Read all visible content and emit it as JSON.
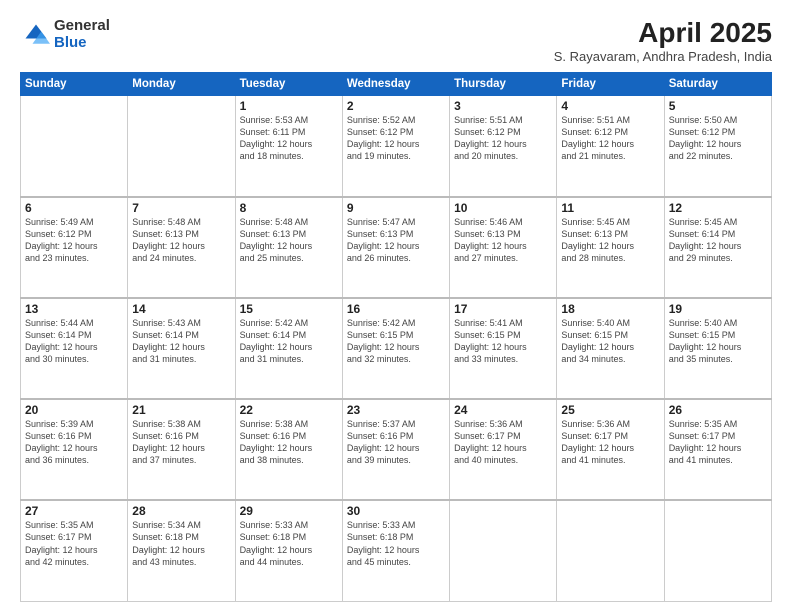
{
  "header": {
    "logo_general": "General",
    "logo_blue": "Blue",
    "title": "April 2025",
    "location": "S. Rayavaram, Andhra Pradesh, India"
  },
  "weekdays": [
    "Sunday",
    "Monday",
    "Tuesday",
    "Wednesday",
    "Thursday",
    "Friday",
    "Saturday"
  ],
  "weeks": [
    [
      {
        "day": "",
        "info": ""
      },
      {
        "day": "",
        "info": ""
      },
      {
        "day": "1",
        "info": "Sunrise: 5:53 AM\nSunset: 6:11 PM\nDaylight: 12 hours\nand 18 minutes."
      },
      {
        "day": "2",
        "info": "Sunrise: 5:52 AM\nSunset: 6:12 PM\nDaylight: 12 hours\nand 19 minutes."
      },
      {
        "day": "3",
        "info": "Sunrise: 5:51 AM\nSunset: 6:12 PM\nDaylight: 12 hours\nand 20 minutes."
      },
      {
        "day": "4",
        "info": "Sunrise: 5:51 AM\nSunset: 6:12 PM\nDaylight: 12 hours\nand 21 minutes."
      },
      {
        "day": "5",
        "info": "Sunrise: 5:50 AM\nSunset: 6:12 PM\nDaylight: 12 hours\nand 22 minutes."
      }
    ],
    [
      {
        "day": "6",
        "info": "Sunrise: 5:49 AM\nSunset: 6:12 PM\nDaylight: 12 hours\nand 23 minutes."
      },
      {
        "day": "7",
        "info": "Sunrise: 5:48 AM\nSunset: 6:13 PM\nDaylight: 12 hours\nand 24 minutes."
      },
      {
        "day": "8",
        "info": "Sunrise: 5:48 AM\nSunset: 6:13 PM\nDaylight: 12 hours\nand 25 minutes."
      },
      {
        "day": "9",
        "info": "Sunrise: 5:47 AM\nSunset: 6:13 PM\nDaylight: 12 hours\nand 26 minutes."
      },
      {
        "day": "10",
        "info": "Sunrise: 5:46 AM\nSunset: 6:13 PM\nDaylight: 12 hours\nand 27 minutes."
      },
      {
        "day": "11",
        "info": "Sunrise: 5:45 AM\nSunset: 6:13 PM\nDaylight: 12 hours\nand 28 minutes."
      },
      {
        "day": "12",
        "info": "Sunrise: 5:45 AM\nSunset: 6:14 PM\nDaylight: 12 hours\nand 29 minutes."
      }
    ],
    [
      {
        "day": "13",
        "info": "Sunrise: 5:44 AM\nSunset: 6:14 PM\nDaylight: 12 hours\nand 30 minutes."
      },
      {
        "day": "14",
        "info": "Sunrise: 5:43 AM\nSunset: 6:14 PM\nDaylight: 12 hours\nand 31 minutes."
      },
      {
        "day": "15",
        "info": "Sunrise: 5:42 AM\nSunset: 6:14 PM\nDaylight: 12 hours\nand 31 minutes."
      },
      {
        "day": "16",
        "info": "Sunrise: 5:42 AM\nSunset: 6:15 PM\nDaylight: 12 hours\nand 32 minutes."
      },
      {
        "day": "17",
        "info": "Sunrise: 5:41 AM\nSunset: 6:15 PM\nDaylight: 12 hours\nand 33 minutes."
      },
      {
        "day": "18",
        "info": "Sunrise: 5:40 AM\nSunset: 6:15 PM\nDaylight: 12 hours\nand 34 minutes."
      },
      {
        "day": "19",
        "info": "Sunrise: 5:40 AM\nSunset: 6:15 PM\nDaylight: 12 hours\nand 35 minutes."
      }
    ],
    [
      {
        "day": "20",
        "info": "Sunrise: 5:39 AM\nSunset: 6:16 PM\nDaylight: 12 hours\nand 36 minutes."
      },
      {
        "day": "21",
        "info": "Sunrise: 5:38 AM\nSunset: 6:16 PM\nDaylight: 12 hours\nand 37 minutes."
      },
      {
        "day": "22",
        "info": "Sunrise: 5:38 AM\nSunset: 6:16 PM\nDaylight: 12 hours\nand 38 minutes."
      },
      {
        "day": "23",
        "info": "Sunrise: 5:37 AM\nSunset: 6:16 PM\nDaylight: 12 hours\nand 39 minutes."
      },
      {
        "day": "24",
        "info": "Sunrise: 5:36 AM\nSunset: 6:17 PM\nDaylight: 12 hours\nand 40 minutes."
      },
      {
        "day": "25",
        "info": "Sunrise: 5:36 AM\nSunset: 6:17 PM\nDaylight: 12 hours\nand 41 minutes."
      },
      {
        "day": "26",
        "info": "Sunrise: 5:35 AM\nSunset: 6:17 PM\nDaylight: 12 hours\nand 41 minutes."
      }
    ],
    [
      {
        "day": "27",
        "info": "Sunrise: 5:35 AM\nSunset: 6:17 PM\nDaylight: 12 hours\nand 42 minutes."
      },
      {
        "day": "28",
        "info": "Sunrise: 5:34 AM\nSunset: 6:18 PM\nDaylight: 12 hours\nand 43 minutes."
      },
      {
        "day": "29",
        "info": "Sunrise: 5:33 AM\nSunset: 6:18 PM\nDaylight: 12 hours\nand 44 minutes."
      },
      {
        "day": "30",
        "info": "Sunrise: 5:33 AM\nSunset: 6:18 PM\nDaylight: 12 hours\nand 45 minutes."
      },
      {
        "day": "",
        "info": ""
      },
      {
        "day": "",
        "info": ""
      },
      {
        "day": "",
        "info": ""
      }
    ]
  ]
}
